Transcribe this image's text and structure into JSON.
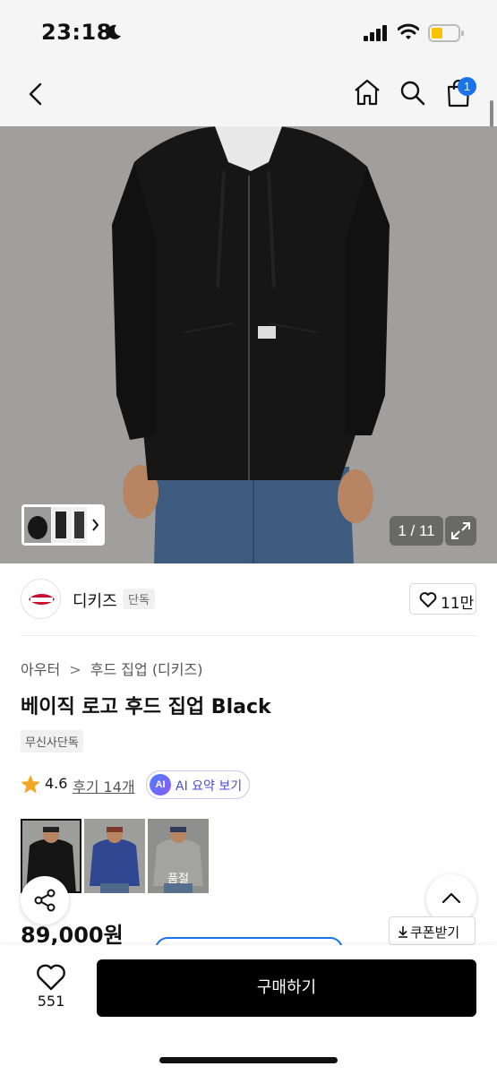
{
  "status_bar": {
    "time": "23:18"
  },
  "nav": {
    "cart_count": "1"
  },
  "gallery": {
    "counter": "1 / 11"
  },
  "brand": {
    "name": "디키즈",
    "tag": "단독",
    "likes": "11만"
  },
  "breadcrumb": {
    "category": "아우터",
    "separator": ">",
    "subcategory": "후드 집업 (디키즈)"
  },
  "product": {
    "title": "베이직 로고 후드 집업 Black",
    "exclusive_tag": "무신사단독",
    "rating": "4.6",
    "reviews_label": "후기 14개",
    "ai_badge": "AI",
    "ai_summary_label": "AI 요약 보기",
    "price": "89,000원",
    "coupon_label": "쿠폰받기"
  },
  "color_options": [
    {
      "color": "Black",
      "label": ""
    },
    {
      "color": "Navy",
      "label": ""
    },
    {
      "color": "Gray",
      "label": "품절"
    }
  ],
  "bottom_bar": {
    "like_count": "551",
    "buy_label": "구매하기"
  },
  "colors": {
    "accent_blue": "#1a73e8",
    "star": "#f5a623",
    "buy_button": "#000000"
  }
}
